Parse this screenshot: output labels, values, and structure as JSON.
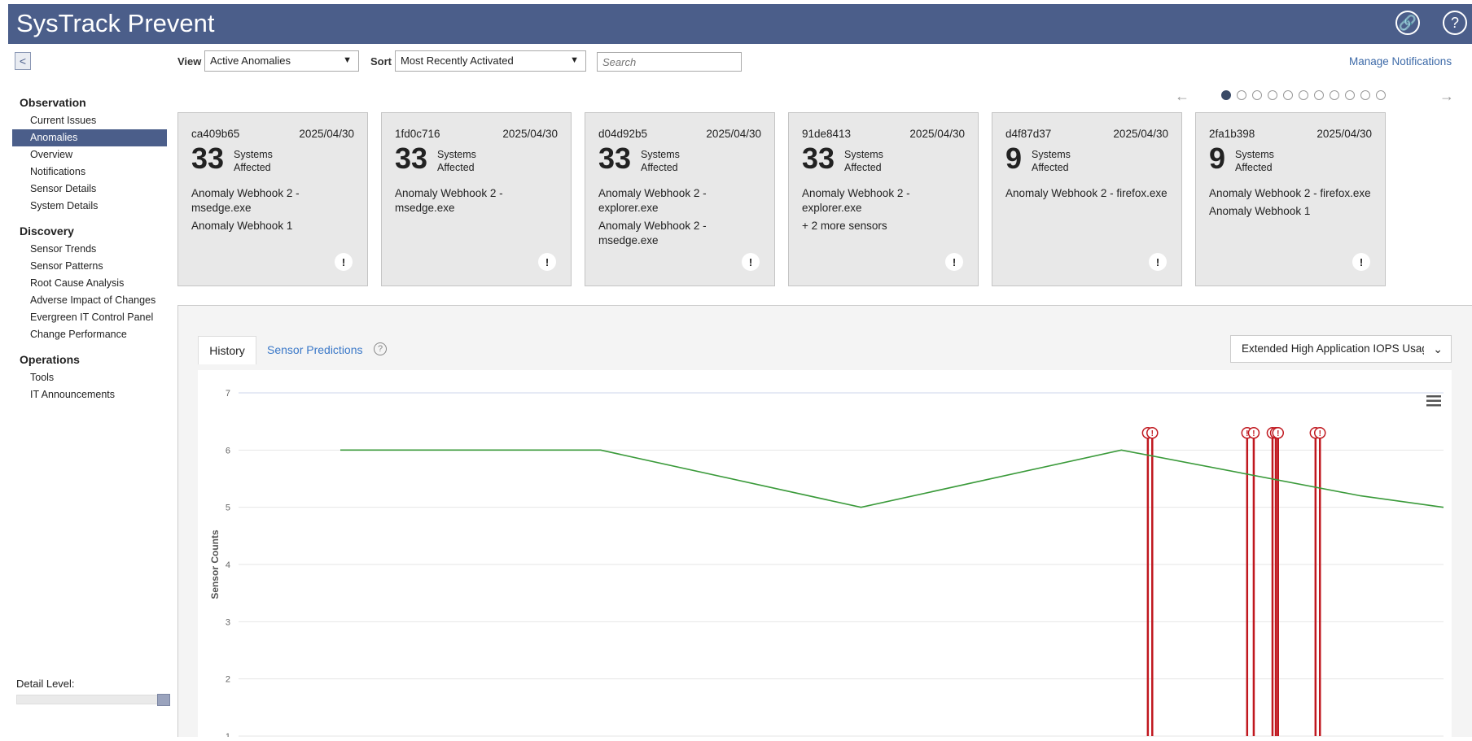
{
  "app": {
    "title": "SysTrack Prevent"
  },
  "header": {
    "link_icon": "link-icon",
    "help_icon": "help-icon"
  },
  "toolbar": {
    "view_label": "View",
    "view_value": "Active Anomalies",
    "sort_label": "Sort",
    "sort_value": "Most Recently Activated",
    "search_placeholder": "Search",
    "manage_notifications": "Manage Notifications"
  },
  "sidebar": {
    "sections": [
      {
        "title": "Observation",
        "items": [
          "Current Issues",
          "Anomalies",
          "Overview",
          "Notifications",
          "Sensor Details",
          "System Details"
        ]
      },
      {
        "title": "Discovery",
        "items": [
          "Sensor Trends",
          "Sensor Patterns",
          "Root Cause Analysis",
          "Adverse Impact of Changes",
          "Evergreen IT Control Panel",
          "Change Performance"
        ]
      },
      {
        "title": "Operations",
        "items": [
          "Tools",
          "IT Announcements"
        ]
      }
    ],
    "active_item": "Anomalies",
    "detail_level_label": "Detail Level:",
    "detail_level": 1.0
  },
  "pager": {
    "total_pages": 11,
    "current_page": 1
  },
  "cards": [
    {
      "id": "ca409b65",
      "date": "2025/04/30",
      "count": "33",
      "systems_label": "Systems",
      "affected_label": "Affected",
      "sensors": [
        "Anomaly Webhook 2 - msedge.exe",
        "Anomaly Webhook 1"
      ]
    },
    {
      "id": "1fd0c716",
      "date": "2025/04/30",
      "count": "33",
      "systems_label": "Systems",
      "affected_label": "Affected",
      "sensors": [
        "Anomaly Webhook 2 - msedge.exe"
      ]
    },
    {
      "id": "d04d92b5",
      "date": "2025/04/30",
      "count": "33",
      "systems_label": "Systems",
      "affected_label": "Affected",
      "sensors": [
        "Anomaly Webhook 2 - explorer.exe",
        "Anomaly Webhook 2 - msedge.exe"
      ]
    },
    {
      "id": "91de8413",
      "date": "2025/04/30",
      "count": "33",
      "systems_label": "Systems",
      "affected_label": "Affected",
      "sensors": [
        "Anomaly Webhook 2 - explorer.exe",
        "+ 2 more sensors"
      ]
    },
    {
      "id": "d4f87d37",
      "date": "2025/04/30",
      "count": "9",
      "systems_label": "Systems",
      "affected_label": "Affected",
      "sensors": [
        "Anomaly Webhook 2 - firefox.exe"
      ]
    },
    {
      "id": "2fa1b398",
      "date": "2025/04/30",
      "count": "9",
      "systems_label": "Systems",
      "affected_label": "Affected",
      "sensors": [
        "Anomaly Webhook 2 - firefox.exe",
        "Anomaly Webhook 1"
      ]
    }
  ],
  "details": {
    "tabs": [
      "History",
      "Sensor Predictions"
    ],
    "active_tab": "History",
    "sensor_select_value": "Extended High Application IOPS Usage"
  },
  "chart_data": {
    "type": "line",
    "ylabel": "Sensor Counts",
    "ylim": [
      1,
      7
    ],
    "yticks": [
      "1",
      "2",
      "3",
      "4",
      "5",
      "6",
      "7"
    ],
    "series": [
      {
        "color": "#3a9a3a",
        "points": [
          {
            "x": 0.0,
            "y": 6
          },
          {
            "x": 0.236,
            "y": 6
          },
          {
            "x": 0.472,
            "y": 5
          },
          {
            "x": 0.708,
            "y": 6
          },
          {
            "x": 0.925,
            "y": 5.2
          },
          {
            "x": 1.0,
            "y": 5
          }
        ]
      }
    ],
    "anomaly_markers": [
      0.732,
      0.736,
      0.822,
      0.828,
      0.845,
      0.848,
      0.85,
      0.884,
      0.888
    ],
    "marker_color": "#c0181f",
    "grid": true
  }
}
